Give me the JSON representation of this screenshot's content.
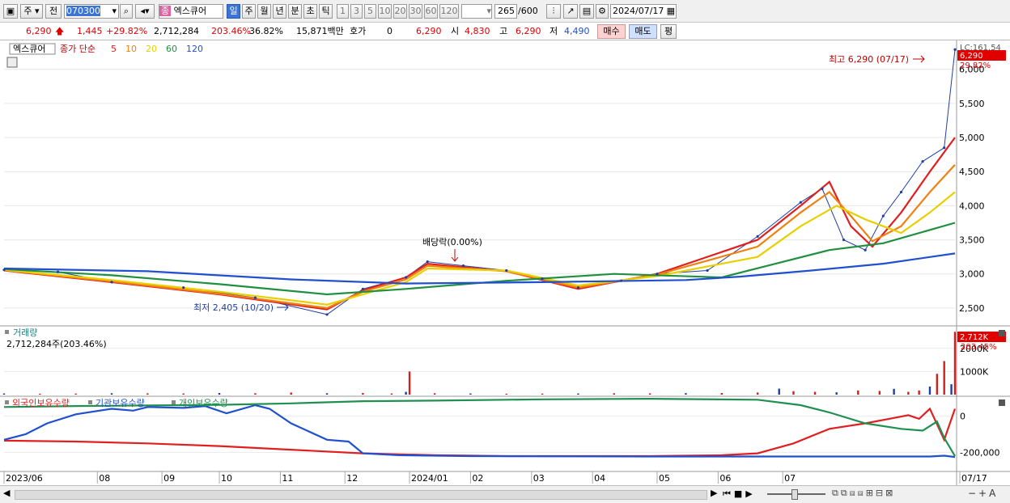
{
  "toolbar": {
    "market": "주",
    "prev": "전",
    "code": "070300",
    "badge": "종",
    "name": "엑스큐어",
    "periods": [
      "일",
      "주",
      "월",
      "년",
      "분",
      "초",
      "틱"
    ],
    "active_period": "일",
    "intervals": [
      "1",
      "3",
      "5",
      "10",
      "20",
      "30",
      "60",
      "120"
    ],
    "count": "265",
    "count_total": "/600",
    "date": "2024/07/17"
  },
  "quote": {
    "price": "6,290",
    "arrow": "up",
    "change": "1,445",
    "change_pct": "+29.82%",
    "volume": "2,712,284",
    "volume_ratio": "203.46%",
    "turnover": "36.82%",
    "amount": "15,871백만",
    "hoga_label": "호가",
    "hoga_value": "0",
    "hoga_price": "6,290",
    "open_label": "시",
    "open": "4,830",
    "high_label": "고",
    "high": "6,290",
    "low_label": "저",
    "low": "4,490",
    "buy": "매수",
    "sell": "매도",
    "eval": "평"
  },
  "panels": {
    "price": {
      "stock_label": "엑스큐어",
      "legend_prefix": "종가 단순",
      "ma": [
        {
          "period": "5",
          "color": "#e02020"
        },
        {
          "period": "10",
          "color": "#f08010"
        },
        {
          "period": "20",
          "color": "#e8d000"
        },
        {
          "period": "60",
          "color": "#209040"
        },
        {
          "period": "120",
          "color": "#2050d0"
        }
      ],
      "right_top_label": "LC:161.54",
      "last_price_tag": "6,290",
      "last_pct_tag": "29.82%",
      "high_annotation": "최고 6,290 (07/17)",
      "low_annotation": "최저 2,405 (10/20)",
      "dividend_annotation": "배당락(0.00%)"
    },
    "volume": {
      "title": "거래량",
      "value_text": "2,712,284주(203.46%)",
      "tag": "2,712K",
      "tag_pct": "203.45%"
    },
    "holdings": {
      "legend": [
        {
          "name": "외국인보유수량",
          "color": "#e02020"
        },
        {
          "name": "기관보유수량",
          "color": "#2050d0"
        },
        {
          "name": "개인보유수량",
          "color": "#209050"
        }
      ]
    }
  },
  "x_axis_labels": [
    "2023/06",
    "08",
    "09",
    "10",
    "11",
    "12",
    "2024/01",
    "02",
    "03",
    "04",
    "05",
    "06",
    "07",
    "07/17"
  ],
  "chart_data": [
    {
      "type": "line",
      "title": "엑스큐어 일봉",
      "y_ticks": [
        2500,
        3000,
        3500,
        4000,
        4500,
        5000,
        5500,
        6000
      ],
      "ylim": [
        2250,
        6400
      ],
      "x_ticks": [
        "2023/06",
        "08",
        "09",
        "10",
        "11",
        "12",
        "2024/01",
        "02",
        "03",
        "04",
        "05",
        "06",
        "07"
      ],
      "series": [
        {
          "name": "종가",
          "x": [
            0,
            15,
            30,
            50,
            70,
            90,
            100,
            112,
            118,
            128,
            140,
            150,
            160,
            172,
            182,
            196,
            210,
            222,
            228,
            234,
            240,
            245,
            250,
            256,
            262,
            265
          ],
          "values": [
            3060,
            3030,
            2880,
            2800,
            2650,
            2405,
            2780,
            2950,
            3180,
            3120,
            3050,
            2930,
            2800,
            2900,
            3000,
            3050,
            3550,
            4050,
            4250,
            3500,
            3350,
            3850,
            4200,
            4650,
            4850,
            6290
          ]
        },
        {
          "name": "5",
          "x": [
            0,
            30,
            60,
            90,
            100,
            112,
            118,
            140,
            160,
            182,
            210,
            222,
            230,
            236,
            242,
            250,
            258,
            265
          ],
          "values": [
            3050,
            2880,
            2700,
            2480,
            2760,
            2950,
            3150,
            3040,
            2780,
            3000,
            3500,
            4000,
            4350,
            3700,
            3400,
            3900,
            4500,
            5000
          ]
        },
        {
          "name": "10",
          "x": [
            0,
            30,
            60,
            90,
            100,
            112,
            118,
            140,
            160,
            182,
            210,
            222,
            230,
            236,
            242,
            250,
            258,
            265
          ],
          "values": [
            3055,
            2890,
            2710,
            2500,
            2740,
            2920,
            3120,
            3040,
            2800,
            2990,
            3400,
            3900,
            4200,
            3850,
            3480,
            3700,
            4200,
            4600
          ]
        },
        {
          "name": "20",
          "x": [
            0,
            30,
            60,
            90,
            100,
            112,
            118,
            140,
            160,
            182,
            210,
            222,
            232,
            240,
            250,
            258,
            265
          ],
          "values": [
            3060,
            2910,
            2740,
            2550,
            2700,
            2880,
            3080,
            3050,
            2830,
            2970,
            3250,
            3700,
            4000,
            3800,
            3600,
            3900,
            4200
          ]
        },
        {
          "name": "60",
          "x": [
            0,
            30,
            60,
            90,
            112,
            140,
            170,
            200,
            215,
            230,
            245,
            265
          ],
          "values": [
            3070,
            2980,
            2850,
            2700,
            2780,
            2900,
            3000,
            2950,
            3150,
            3350,
            3450,
            3750
          ]
        },
        {
          "name": "120",
          "x": [
            0,
            40,
            80,
            112,
            150,
            190,
            205,
            225,
            245,
            265
          ],
          "values": [
            3080,
            3040,
            2920,
            2860,
            2880,
            2910,
            2960,
            3050,
            3150,
            3300
          ]
        }
      ]
    },
    {
      "type": "bar",
      "title": "거래량",
      "y_ticks": [
        1000000,
        2000000
      ],
      "ylim": [
        0,
        2900000
      ],
      "x": [
        0,
        10,
        20,
        30,
        40,
        50,
        60,
        70,
        80,
        90,
        100,
        108,
        112,
        113,
        120,
        130,
        140,
        150,
        160,
        170,
        180,
        190,
        200,
        210,
        216,
        220,
        226,
        232,
        238,
        244,
        248,
        252,
        255,
        258,
        260,
        262,
        264,
        265
      ],
      "values": [
        50000,
        40000,
        45000,
        60000,
        55000,
        50000,
        70000,
        60000,
        90000,
        60000,
        70000,
        50000,
        120000,
        1000000,
        60000,
        50000,
        40000,
        45000,
        50000,
        60000,
        55000,
        65000,
        70000,
        90000,
        260000,
        150000,
        120000,
        100000,
        180000,
        160000,
        250000,
        120000,
        180000,
        350000,
        900000,
        1450000,
        450000,
        2712284
      ]
    },
    {
      "type": "line",
      "title": "보유수량",
      "y_ticks": [
        0,
        -200000
      ],
      "ylim": [
        -300000,
        100000
      ],
      "series": [
        {
          "name": "외국인보유수량",
          "x": [
            0,
            20,
            40,
            60,
            80,
            100,
            120,
            140,
            160,
            180,
            200,
            210,
            220,
            230,
            240,
            248,
            252,
            255,
            258,
            262,
            265
          ],
          "values": [
            -135000,
            -140000,
            -150000,
            -165000,
            -185000,
            -205000,
            -215000,
            -220000,
            -220000,
            -220000,
            -215000,
            -205000,
            -150000,
            -70000,
            -40000,
            -10000,
            5000,
            -15000,
            40000,
            -130000,
            40000
          ]
        },
        {
          "name": "기관보유수량",
          "x": [
            0,
            6,
            12,
            20,
            30,
            36,
            40,
            50,
            56,
            62,
            70,
            74,
            80,
            90,
            96,
            100,
            110,
            130,
            180,
            230,
            258,
            262,
            265
          ],
          "values": [
            -130000,
            -100000,
            -40000,
            10000,
            40000,
            30000,
            50000,
            45000,
            55000,
            15000,
            60000,
            40000,
            -40000,
            -130000,
            -140000,
            -205000,
            -215000,
            -220000,
            -222000,
            -222000,
            -222000,
            -218000,
            -225000
          ]
        },
        {
          "name": "개인보유수량",
          "x": [
            0,
            20,
            40,
            60,
            80,
            100,
            120,
            150,
            180,
            210,
            222,
            230,
            240,
            250,
            256,
            260,
            262,
            265
          ],
          "values": [
            50000,
            55000,
            58000,
            62000,
            70000,
            82000,
            85000,
            92000,
            95000,
            90000,
            60000,
            20000,
            -40000,
            -70000,
            -80000,
            -30000,
            -120000,
            -220000
          ]
        }
      ]
    }
  ],
  "scroll": {
    "left_arrow": "◀",
    "right_arrow": "▶"
  }
}
